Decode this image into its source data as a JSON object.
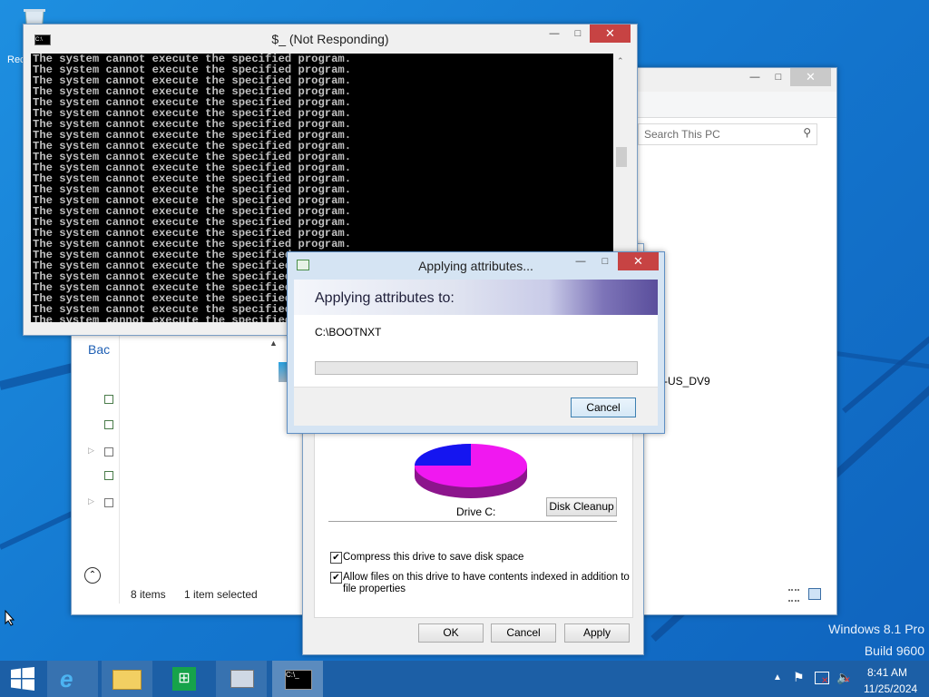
{
  "desktop": {
    "recycle_label": "Rec",
    "watermark_line1": "Windows 8.1 Pro",
    "watermark_line2": "Build 9600"
  },
  "console": {
    "title": "$_ (Not Responding)",
    "lines": [
      "The system cannot execute the specified program.",
      "The system cannot execute the specified program.",
      "The system cannot execute the specified program.",
      "The system cannot execute the specified program.",
      "The system cannot execute the specified program.",
      "The system cannot execute the specified program.",
      "The system cannot execute the specified program.",
      "The system cannot execute the specified program.",
      "The system cannot execute the specified program.",
      "The system cannot execute the specified program.",
      "The system cannot execute the specified program.",
      "The system cannot execute the specified program.",
      "The system cannot execute the specified program.",
      "The system cannot execute the specified program.",
      "The system cannot execute the specified program.",
      "The system cannot execute the specified program.",
      "The system cannot execute the specified program.",
      "The system cannot execute the specified program.",
      "The system cannot execute the specified program.",
      "The system cannot execute the specified program.",
      "The system cannot execute the specified program.",
      "The system cannot execute the specified program.",
      "The system cannot execute the specified program.",
      "The system cannot execute the specified program.",
      "The system cannot execute the specified program."
    ]
  },
  "explorer": {
    "search_placeholder": "Search This PC",
    "back_label": "Bac",
    "status_items": "8 items",
    "status_selected": "1 item selected",
    "drive_label_partial": "-US_DV9"
  },
  "properties": {
    "drive_caption": "Drive C:",
    "disk_cleanup": "Disk Cleanup",
    "compress_label": "Compress this drive to save disk space",
    "compress_checked": true,
    "index_label_line1": "Allow files on this drive to have contents indexed in addition to",
    "index_label_line2": "file properties",
    "index_checked": true,
    "ok": "OK",
    "cancel": "Cancel",
    "apply": "Apply",
    "used_fraction": 0.25
  },
  "dialog": {
    "title": "Applying attributes...",
    "heading": "Applying attributes to:",
    "path": "C:\\BOOTNXT",
    "progress": 0,
    "cancel": "Cancel"
  },
  "taskbar": {
    "time": "8:41 AM",
    "date": "11/25/2024"
  },
  "colors": {
    "desktop": "#1478d0",
    "close_red": "#c74343",
    "pie_used": "#1515f0",
    "pie_free": "#f018f0"
  }
}
